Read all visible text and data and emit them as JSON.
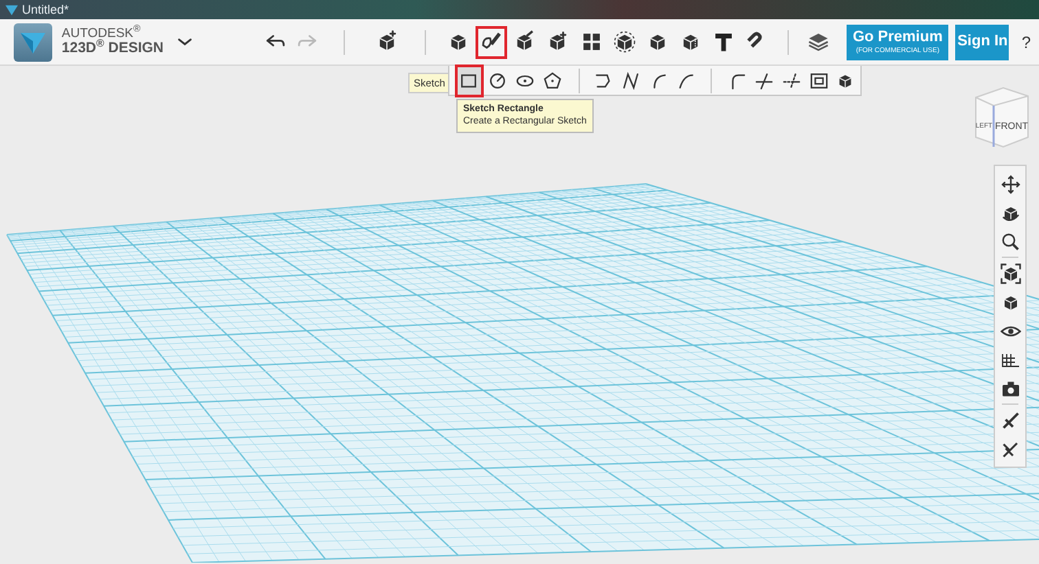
{
  "window": {
    "title": "Untitled*"
  },
  "logo": {
    "brand": "AUTODESK$^{®}$",
    "product": "123D$^{®}$ DESIGN"
  },
  "history": [
    {
      "kind": "undo",
      "disabled": false
    },
    {
      "kind": "redo",
      "disabled": true
    }
  ],
  "import_tool": {
    "kind": "import",
    "selected": false
  },
  "main_tools": [
    {
      "kind": "primitives",
      "selected": false
    },
    {
      "kind": "sketch",
      "selected": true
    },
    {
      "kind": "construct",
      "selected": false
    },
    {
      "kind": "modify",
      "selected": false
    },
    {
      "kind": "pattern",
      "selected": false
    },
    {
      "kind": "group",
      "selected": false
    },
    {
      "kind": "combine",
      "selected": false
    },
    {
      "kind": "measure",
      "selected": false
    },
    {
      "kind": "text",
      "selected": false
    },
    {
      "kind": "snap",
      "selected": false
    }
  ],
  "materials_tool": {
    "kind": "layers",
    "selected": false
  },
  "premium_button": {
    "label": "Go Premium",
    "sublabel": "(FOR COMMERCIAL USE)"
  },
  "sign_in_button": {
    "label": "Sign In"
  },
  "help_button": {
    "label": "?"
  },
  "sketch_tools": {
    "group_label": "Sketch",
    "groups": [
      [
        {
          "kind": "rectangle",
          "selected": true
        },
        {
          "kind": "circle",
          "selected": false
        },
        {
          "kind": "ellipse",
          "selected": false
        },
        {
          "kind": "polygon",
          "selected": false
        }
      ],
      [
        {
          "kind": "polyline",
          "selected": false
        },
        {
          "kind": "spline",
          "selected": false
        },
        {
          "kind": "arc2",
          "selected": false
        },
        {
          "kind": "arc3",
          "selected": false
        }
      ],
      [
        {
          "kind": "fillet",
          "selected": false
        },
        {
          "kind": "trim",
          "selected": false
        },
        {
          "kind": "extend",
          "selected": false
        },
        {
          "kind": "offset",
          "selected": false
        },
        {
          "kind": "project",
          "selected": false
        }
      ]
    ]
  },
  "tooltip": {
    "title": "Sketch Rectangle",
    "text": "Create a Rectangular Sketch"
  },
  "view_cube": {
    "left_face": "LEFT",
    "front_face": "FRONT"
  },
  "navigation": [
    {
      "kind": "pan"
    },
    {
      "kind": "orbit"
    },
    {
      "kind": "zoom"
    },
    {
      "kind": "fit"
    },
    {
      "kind": "views"
    },
    {
      "kind": "visibility"
    },
    {
      "kind": "materials"
    },
    {
      "kind": "screenshot"
    },
    {
      "kind": "snap1"
    },
    {
      "kind": "snap2"
    }
  ]
}
